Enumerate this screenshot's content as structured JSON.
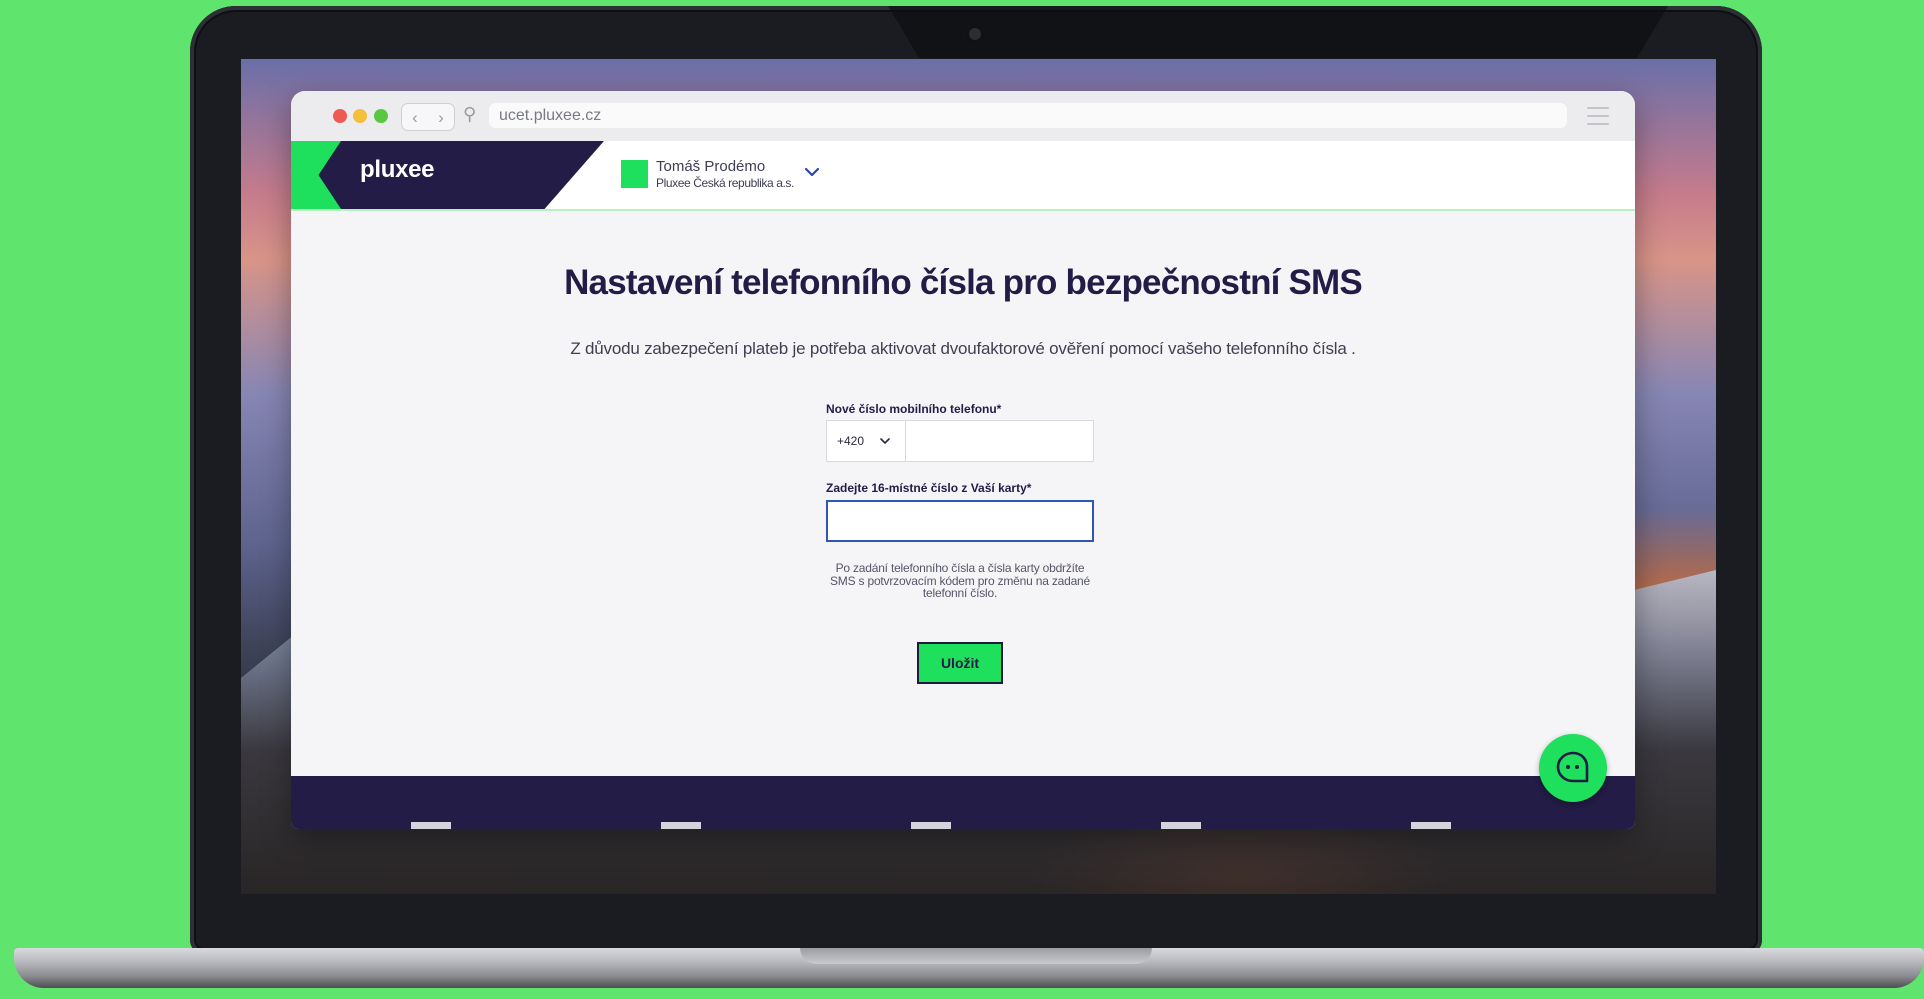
{
  "browser": {
    "url": "ucet.pluxee.cz",
    "back_glyph": "‹",
    "forward_glyph": "›",
    "search_glyph": "⚲"
  },
  "header": {
    "logo": "pluxee",
    "account_name": "Tomáš Prodémo",
    "account_company": "Pluxee Česká republika a.s.",
    "account_chevron": "⌄"
  },
  "main": {
    "title": "Nastavení telefonního čísla pro bezpečnostní SMS",
    "subtitle": "Z důvodu zabezpečení plateb je potřeba aktivovat dvoufaktorové ověření pomocí vašeho telefonního čísla .",
    "phone_label": "Nové číslo mobilního telefonu*",
    "phone_prefix": "+420",
    "phone_value": "",
    "card_label": "Zadejte 16-místné číslo z Vaší karty*",
    "card_value": "",
    "hint": "Po zadání telefonního čísla a čísla karty obdržíte SMS s potvrzovacím kódem pro změnu na zadané telefonní číslo.",
    "save_label": "Uložit"
  },
  "colors": {
    "brand_green": "#1ee05c",
    "brand_navy": "#221c46",
    "focus_blue": "#3056b5",
    "backdrop": "#5fe46d"
  },
  "icons": {
    "chat": "chat-bubble-icon",
    "menu": "hamburger-menu-icon",
    "search": "search-icon"
  }
}
